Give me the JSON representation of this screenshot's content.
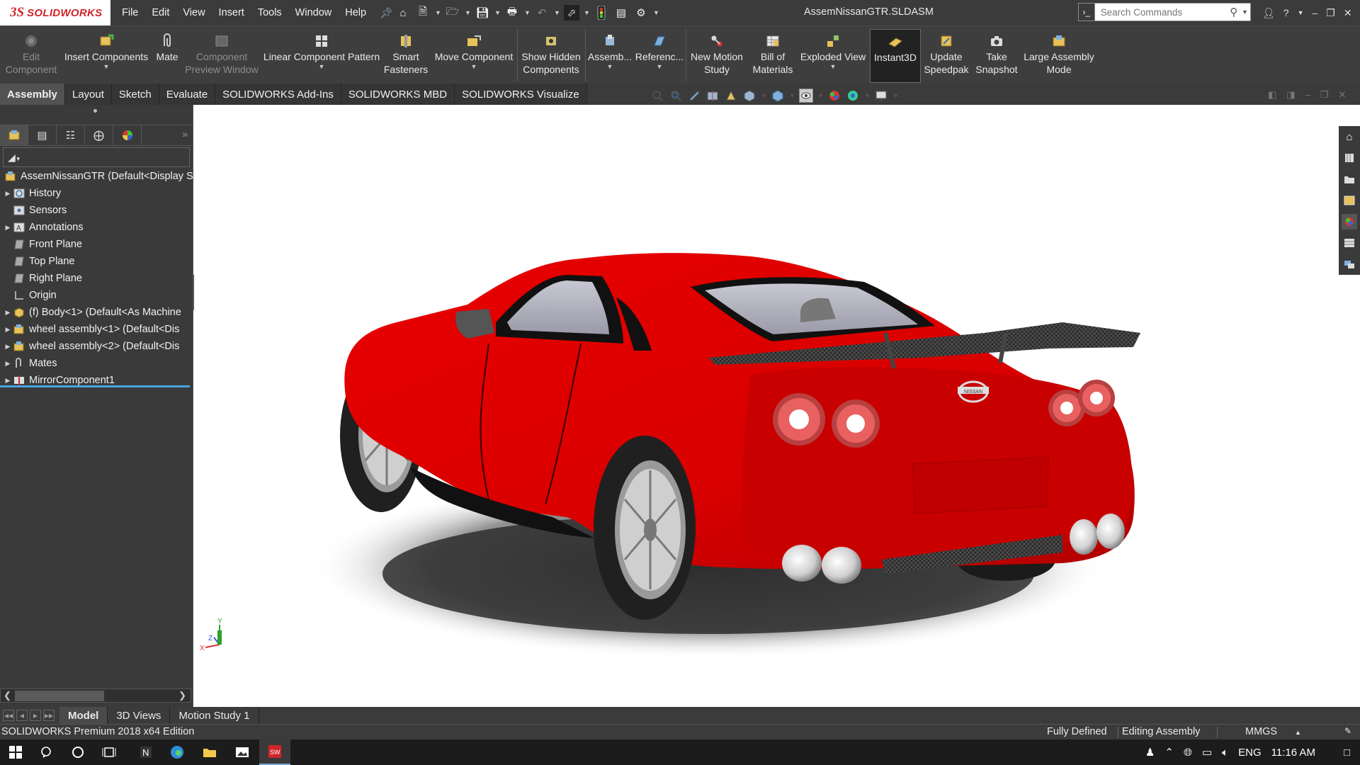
{
  "app": {
    "logo_prefix": "3S",
    "logo_text": "SOLIDWORKS",
    "doc_title": "AssemNissanGTR.SLDASM"
  },
  "menu": [
    "File",
    "Edit",
    "View",
    "Insert",
    "Tools",
    "Window",
    "Help"
  ],
  "search": {
    "placeholder": "Search Commands"
  },
  "commands": {
    "edit_component": [
      "Edit",
      "Component"
    ],
    "insert_components": "Insert Components",
    "mate": "Mate",
    "component_preview": [
      "Component",
      "Preview Window"
    ],
    "linear_pattern": "Linear Component Pattern",
    "smart_fasteners": [
      "Smart",
      "Fasteners"
    ],
    "move_component": "Move Component",
    "show_hidden": [
      "Show Hidden",
      "Components"
    ],
    "assembly_features": "Assemb...",
    "reference_geometry": "Referenc...",
    "new_motion_study": [
      "New Motion",
      "Study"
    ],
    "bill_of_materials": [
      "Bill of",
      "Materials"
    ],
    "exploded_view": "Exploded View",
    "instant3d": "Instant3D",
    "update_speedpak": [
      "Update",
      "Speedpak"
    ],
    "take_snapshot": [
      "Take",
      "Snapshot"
    ],
    "large_assembly_mode": [
      "Large Assembly",
      "Mode"
    ]
  },
  "tabs": [
    "Assembly",
    "Layout",
    "Sketch",
    "Evaluate",
    "SOLIDWORKS Add-Ins",
    "SOLIDWORKS MBD",
    "SOLIDWORKS Visualize"
  ],
  "tree": {
    "root": "AssemNissanGTR  (Default<Display S",
    "items": [
      {
        "label": "History",
        "expandable": true,
        "icon": "history-icon"
      },
      {
        "label": "Sensors",
        "expandable": false,
        "icon": "sensors-icon"
      },
      {
        "label": "Annotations",
        "expandable": true,
        "icon": "annotations-icon"
      },
      {
        "label": "Front Plane",
        "expandable": false,
        "icon": "plane-icon"
      },
      {
        "label": "Top Plane",
        "expandable": false,
        "icon": "plane-icon"
      },
      {
        "label": "Right Plane",
        "expandable": false,
        "icon": "plane-icon"
      },
      {
        "label": "Origin",
        "expandable": false,
        "icon": "origin-icon"
      },
      {
        "label": "(f) Body<1> (Default<As Machine",
        "expandable": true,
        "icon": "part-icon"
      },
      {
        "label": "wheel assembly<1> (Default<Dis",
        "expandable": true,
        "icon": "subassembly-icon"
      },
      {
        "label": "wheel assembly<2> (Default<Dis",
        "expandable": true,
        "icon": "subassembly-icon"
      },
      {
        "label": "Mates",
        "expandable": true,
        "icon": "mates-icon"
      },
      {
        "label": "MirrorComponent1",
        "expandable": true,
        "icon": "mirror-component-icon"
      }
    ]
  },
  "bottom_tabs": [
    "Model",
    "3D Views",
    "Motion Study 1"
  ],
  "status": {
    "edition": "SOLIDWORKS Premium 2018 x64 Edition",
    "defined": "Fully Defined",
    "mode": "Editing Assembly",
    "units": "MMGS"
  },
  "taskbar": {
    "language": "ENG",
    "time": "11:16 AM"
  },
  "triad": {
    "x": "X",
    "y": "Y",
    "z": "Z"
  },
  "car": {
    "badge": "NISSAN",
    "body_color": "#e00000"
  },
  "colors": {
    "ui_dark": "#3b3b3b",
    "brand_red": "#d2232a",
    "selection_blue": "#4aa3df"
  }
}
